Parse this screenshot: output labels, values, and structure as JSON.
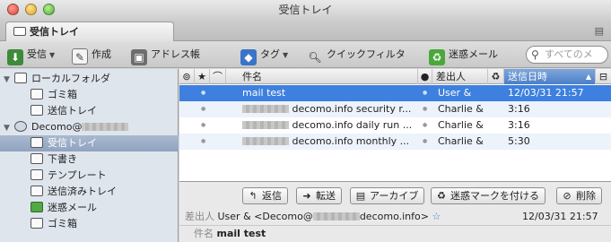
{
  "window": {
    "title": "受信トレイ"
  },
  "tabs": [
    {
      "label": "受信トレイ"
    }
  ],
  "toolbar": {
    "get_mail": "受信",
    "compose": "作成",
    "address_book": "アドレス帳",
    "tag": "タグ",
    "quick_filter": "クイックフィルタ",
    "junk": "迷惑メール",
    "search_placeholder": "すべてのメ"
  },
  "sidebar": {
    "local_folders": "ローカルフォルダ",
    "local_trash": "ゴミ箱",
    "local_outbox": "送信トレイ",
    "account": "Decomo@",
    "inbox": "受信トレイ",
    "drafts": "下書き",
    "templates": "テンプレート",
    "sent": "送信済みトレイ",
    "junk": "迷惑メール",
    "trash": "ゴミ箱"
  },
  "list": {
    "columns": {
      "subject": "件名",
      "sender": "差出人",
      "date": "送信日時"
    },
    "rows": [
      {
        "subject": "mail test",
        "sender": "User &",
        "date": "12/03/31 21:57"
      },
      {
        "subject": "decomo.info security r...",
        "sender": "Charlie &",
        "date": "3:16"
      },
      {
        "subject": "decomo.info daily run ...",
        "sender": "Charlie &",
        "date": "3:16"
      },
      {
        "subject": "decomo.info monthly ...",
        "sender": "Charlie &",
        "date": "5:30"
      }
    ]
  },
  "preview": {
    "reply": "返信",
    "forward": "転送",
    "archive": "アーカイブ",
    "mark_junk": "迷惑マークを付ける",
    "delete": "削除",
    "from_label": "差出人",
    "from_value_prefix": "User & <Decomo@",
    "from_value_suffix": "decomo.info>",
    "date": "12/03/31 21:57",
    "subject_label": "件名",
    "subject_value": "mail test"
  }
}
